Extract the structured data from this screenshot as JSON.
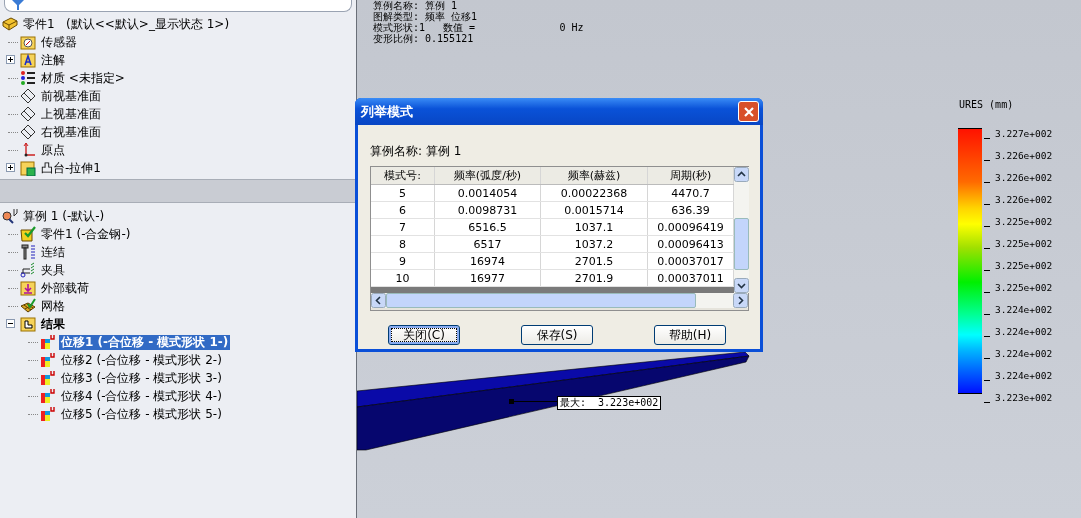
{
  "feature_tree": {
    "label": "零件1   (默认<<默认>_显示状态 1>)",
    "kind": "part",
    "children": [
      {
        "label": "传感器",
        "kind": "sensor-folder"
      },
      {
        "label": "注解",
        "kind": "annotation-folder",
        "expanded": false
      },
      {
        "label": "材质 <未指定>",
        "kind": "material"
      },
      {
        "label": "前视基准面",
        "kind": "plane"
      },
      {
        "label": "上视基准面",
        "kind": "plane"
      },
      {
        "label": "右视基准面",
        "kind": "plane"
      },
      {
        "label": "原点",
        "kind": "origin"
      },
      {
        "label": "凸台-拉伸1",
        "kind": "extrude",
        "expanded": false
      }
    ]
  },
  "study_tree": {
    "label": "算例 1 (-默认-)",
    "kind": "study",
    "children": [
      {
        "label": "零件1 (-合金钢-)",
        "kind": "part-check"
      },
      {
        "label": "连结",
        "kind": "connector"
      },
      {
        "label": "夹具",
        "kind": "fixture"
      },
      {
        "label": "外部载荷",
        "kind": "load"
      },
      {
        "label": "网格",
        "kind": "mesh"
      },
      {
        "label": "结果",
        "kind": "results-folder",
        "expanded": true,
        "emphasized": true,
        "children": [
          {
            "label": "位移1 (-合位移 - 模式形状 1-)",
            "kind": "plot",
            "selected": true
          },
          {
            "label": "位移2 (-合位移 - 模式形状 2-)",
            "kind": "plot",
            "selected": false
          },
          {
            "label": "位移3 (-合位移 - 模式形状 3-)",
            "kind": "plot",
            "selected": false
          },
          {
            "label": "位移4 (-合位移 - 模式形状 4-)",
            "kind": "plot",
            "selected": false
          },
          {
            "label": "位移5 (-合位移 - 模式形状 5-)",
            "kind": "plot",
            "selected": false
          }
        ]
      }
    ]
  },
  "plot_info": [
    "算例名称: 算例 1",
    "图解类型: 频率 位移1",
    "模式形状:1   数值 =              0 Hz",
    "变形比例: 0.155121"
  ],
  "legend": {
    "title": "URES (mm)",
    "ticks": [
      "3.227e+002",
      "3.226e+002",
      "3.226e+002",
      "3.226e+002",
      "3.225e+002",
      "3.225e+002",
      "3.225e+002",
      "3.225e+002",
      "3.224e+002",
      "3.224e+002",
      "3.224e+002",
      "3.224e+002",
      "3.223e+002"
    ]
  },
  "annotation": {
    "label": "最大:  3.223e+002"
  },
  "dialog": {
    "title": "列举模式",
    "study_name": "算例名称: 算例 1",
    "table": {
      "columns": [
        "模式号:",
        "频率(弧度/秒)",
        "频率(赫兹)",
        "周期(秒)"
      ],
      "rows": [
        [
          "5",
          "0.0014054",
          "0.00022368",
          "4470.7"
        ],
        [
          "6",
          "0.0098731",
          "0.0015714",
          "636.39"
        ],
        [
          "7",
          "6516.5",
          "1037.1",
          "0.00096419"
        ],
        [
          "8",
          "6517",
          "1037.2",
          "0.00096413"
        ],
        [
          "9",
          "16974",
          "2701.5",
          "0.00037017"
        ],
        [
          "10",
          "16977",
          "2701.9",
          "0.00037011"
        ]
      ]
    },
    "buttons": [
      {
        "label": "关闭(C)",
        "default": true
      },
      {
        "label": "保存(S)",
        "default": false
      },
      {
        "label": "帮助(H)",
        "default": false
      }
    ]
  }
}
